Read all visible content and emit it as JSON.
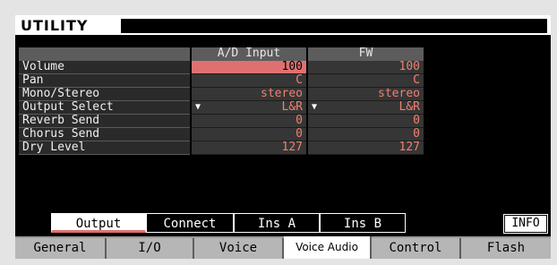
{
  "header": {
    "title": "UTILITY"
  },
  "table": {
    "columns": [
      "A/D Input",
      "FW"
    ],
    "rows": [
      {
        "label": "Volume",
        "values": [
          "100",
          "100"
        ]
      },
      {
        "label": "Pan",
        "values": [
          "C",
          "C"
        ]
      },
      {
        "label": "Mono/Stereo",
        "values": [
          "stereo",
          "stereo"
        ]
      },
      {
        "label": "Output Select",
        "values": [
          "L&R",
          "L&R"
        ]
      },
      {
        "label": "Reverb Send",
        "values": [
          "0",
          "0"
        ]
      },
      {
        "label": "Chorus Send",
        "values": [
          "0",
          "0"
        ]
      },
      {
        "label": "Dry Level",
        "values": [
          "127",
          "127"
        ]
      }
    ],
    "selected": {
      "row": "Volume",
      "column": "A/D Input"
    }
  },
  "subtabs": {
    "items": [
      "Output",
      "Connect",
      "Ins A",
      "Ins B"
    ],
    "active": "Output",
    "info_label": "INFO"
  },
  "tabs": {
    "items": [
      "General",
      "I/O",
      "Voice",
      "Voice Audio",
      "Control",
      "Flash"
    ],
    "active": "Voice Audio"
  },
  "colors": {
    "accent": "#e07070",
    "value_text": "#f08070"
  },
  "icons": {
    "dropdown": "triangle-down-icon"
  }
}
